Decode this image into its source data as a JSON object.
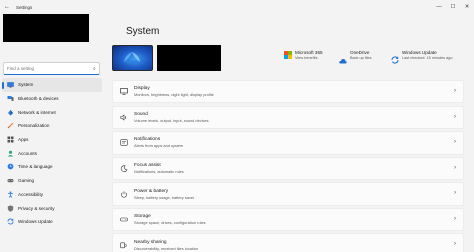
{
  "app": {
    "title": "Settings"
  },
  "window_controls": {
    "minimize": "—",
    "maximize": "☐",
    "close": "✕"
  },
  "search": {
    "placeholder": "Find a setting"
  },
  "sidebar": {
    "items": [
      {
        "label": "System",
        "active": true
      },
      {
        "label": "Bluetooth & devices",
        "active": false
      },
      {
        "label": "Network & internet",
        "active": false
      },
      {
        "label": "Personalization",
        "active": false
      },
      {
        "label": "Apps",
        "active": false
      },
      {
        "label": "Accounts",
        "active": false
      },
      {
        "label": "Time & language",
        "active": false
      },
      {
        "label": "Gaming",
        "active": false
      },
      {
        "label": "Accessibility",
        "active": false
      },
      {
        "label": "Privacy & security",
        "active": false
      },
      {
        "label": "Windows Update",
        "active": false
      }
    ]
  },
  "main": {
    "title": "System",
    "quick_links": [
      {
        "title": "Microsoft 365",
        "subtitle": "View benefits"
      },
      {
        "title": "OneDrive",
        "subtitle": "Back up files"
      },
      {
        "title": "Windows Update",
        "subtitle": "Last checked: 15 minutes ago"
      }
    ],
    "cards": [
      {
        "title": "Display",
        "subtitle": "Monitors, brightness, night light, display profile"
      },
      {
        "title": "Sound",
        "subtitle": "Volume levels, output, input, sound devices"
      },
      {
        "title": "Notifications",
        "subtitle": "Alerts from apps and system"
      },
      {
        "title": "Focus assist",
        "subtitle": "Notifications, automatic rules"
      },
      {
        "title": "Power & battery",
        "subtitle": "Sleep, battery usage, battery saver"
      },
      {
        "title": "Storage",
        "subtitle": "Storage space, drives, configuration rules"
      },
      {
        "title": "Nearby sharing",
        "subtitle": "Discoverability, received files location"
      }
    ]
  },
  "colors": {
    "accent": "#1f6fd1",
    "background": "#f3f3f3",
    "card": "#fbfbfb"
  }
}
